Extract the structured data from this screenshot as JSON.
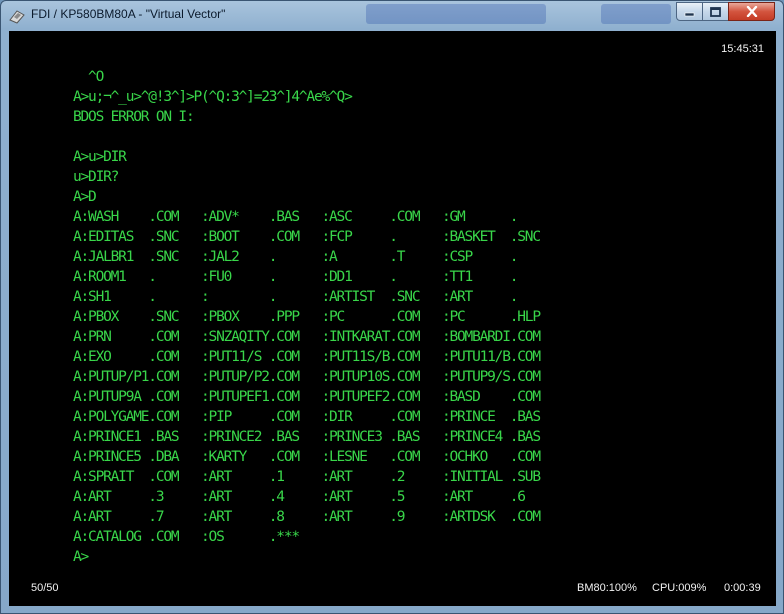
{
  "window": {
    "title": "FDI / KP580BM80A - \"Virtual Vector\"",
    "icon": "floppy-disk-icon"
  },
  "controls": {
    "minimize": "minimize-icon",
    "maximize": "maximize-icon",
    "close": "close-icon"
  },
  "terminal": {
    "clock": "15:45:31",
    "lines": [
      "  ^O",
      "A>u;¬^_u>^@!3^]>P(^Q:3^]=23^]4^Ae%^Q>",
      "BDOS ERROR ON I:",
      "",
      "A>u>DIR",
      "u>DIR?",
      "A>D",
      "A:WASH    .COM   :ADV*    .BAS   :ASC     .COM   :GM      .",
      "A:EDITAS  .SNC   :BOOT    .COM   :FCP     .      :BASKET  .SNC",
      "A:JALBR1  .SNC   :JAL2    .      :A       .T     :CSP     .",
      "A:ROOM1   .      :FU0     .      :DD1     .      :TT1     .",
      "A:SH1     .      :        .      :ARTIST  .SNC   :ART     .",
      "A:PBOX    .SNC   :PBOX    .PPP   :PC      .COM   :PC      .HLP",
      "A:PRN     .COM   :SNZAQITY.COM   :INTKARAT.COM   :BOMBARDI.COM",
      "A:EXO     .COM   :PUT11/S .COM   :PUT11S/B.COM   :PUTU11/B.COM",
      "A:PUTUP/P1.COM   :PUTUP/P2.COM   :PUTUP10S.COM   :PUTUP9/S.COM",
      "A:PUTUP9A .COM   :PUTUPEF1.COM   :PUTUPEF2.COM   :BASD    .COM",
      "A:POLYGAME.COM   :PIP     .COM   :DIR     .COM   :PRINCE  .BAS",
      "A:PRINCE1 .BAS   :PRINCE2 .BAS   :PRINCE3 .BAS   :PRINCE4 .BAS",
      "A:PRINCE5 .DBA   :KARTY   .COM   :LESNE   .COM   :OCHKO   .COM",
      "A:SPRAIT  .COM   :ART     .1     :ART     .2     :INITIAL .SUB",
      "A:ART     .3     :ART     .4     :ART     .5     :ART     .6",
      "A:ART     .7     :ART     .8     :ART     .9     :ARTDSK  .COM",
      "A:CATALOG .COM   :OS      .***",
      "A>"
    ]
  },
  "status": {
    "page": "50/50",
    "mem": "BM80:100%",
    "cpu": "CPU:009%",
    "time": "0:00:39"
  }
}
